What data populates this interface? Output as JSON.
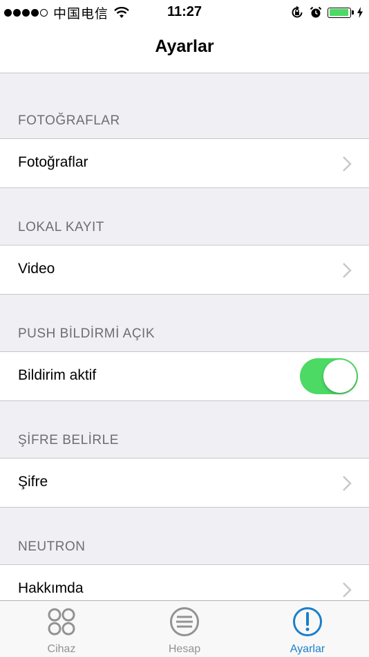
{
  "status_bar": {
    "carrier": "中国电信",
    "time": "11:27"
  },
  "nav": {
    "title": "Ayarlar"
  },
  "sections": [
    {
      "header": "FOTOĞRAFLAR",
      "row": {
        "label": "Fotoğraflar",
        "accessory": "chevron"
      }
    },
    {
      "header": "LOKAL KAYIT",
      "row": {
        "label": "Video",
        "accessory": "chevron"
      }
    },
    {
      "header": "PUSH BİLDİRMİ AÇIK",
      "row": {
        "label": "Bildirim aktif",
        "accessory": "toggle",
        "toggle_on": true
      }
    },
    {
      "header": "ŞİFRE BELİRLE",
      "row": {
        "label": "Şifre",
        "accessory": "chevron"
      }
    },
    {
      "header": "NEUTRON",
      "row": {
        "label": "Hakkımda",
        "accessory": "chevron"
      }
    }
  ],
  "tabs": [
    {
      "label": "Cihaz",
      "icon": "four-circles-icon",
      "active": false
    },
    {
      "label": "Hesap",
      "icon": "list-circle-icon",
      "active": false
    },
    {
      "label": "Ayarlar",
      "icon": "exclamation-circle-icon",
      "active": true
    }
  ],
  "colors": {
    "background": "#efeff4",
    "accent_green": "#4cd964",
    "tab_active": "#1a7fc9",
    "tab_inactive": "#929292",
    "section_header": "#6d6d72"
  }
}
